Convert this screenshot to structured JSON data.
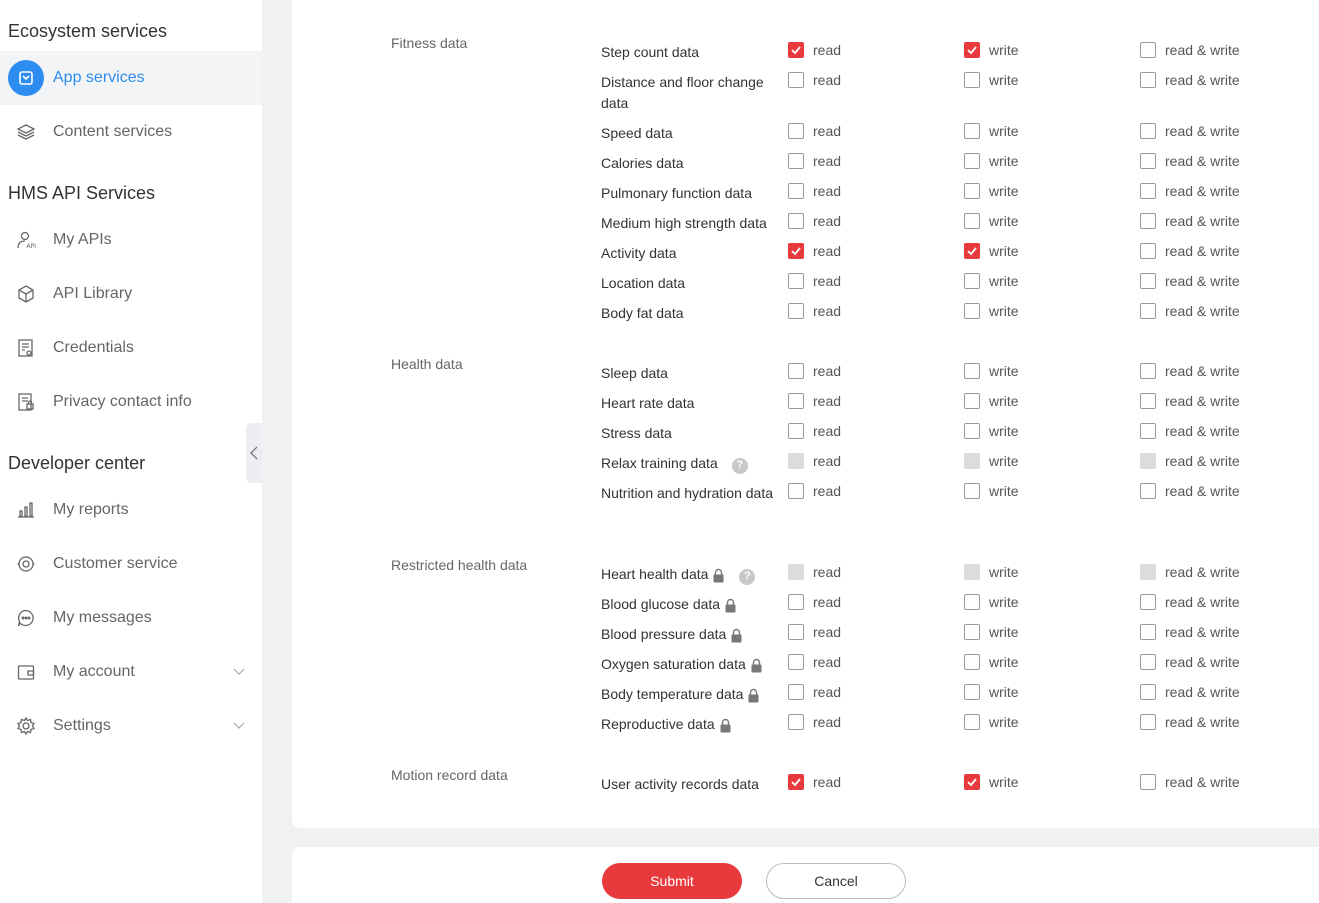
{
  "sidebar": {
    "sections": [
      {
        "title": "Ecosystem services"
      },
      {
        "title": "HMS API Services"
      },
      {
        "title": "Developer center"
      }
    ],
    "items": [
      {
        "label": "App services",
        "icon": "app-services-icon"
      },
      {
        "label": "Content services",
        "icon": "layers-icon"
      },
      {
        "label": "My APIs",
        "icon": "user-api-icon"
      },
      {
        "label": "API Library",
        "icon": "cube-icon"
      },
      {
        "label": "Credentials",
        "icon": "certificate-icon"
      },
      {
        "label": "Privacy contact info",
        "icon": "privacy-doc-icon"
      },
      {
        "label": "My reports",
        "icon": "bar-chart-icon"
      },
      {
        "label": "Customer service",
        "icon": "headset-icon"
      },
      {
        "label": "My messages",
        "icon": "chat-bubble-icon"
      },
      {
        "label": "My account",
        "icon": "wallet-icon"
      },
      {
        "label": "Settings",
        "icon": "gear-icon"
      }
    ]
  },
  "options": {
    "read": "read",
    "write": "write",
    "rw": "read & write"
  },
  "groups": [
    {
      "label": "Fitness data",
      "items": [
        {
          "label": "Step count data",
          "read": "checked",
          "write": "checked",
          "rw": "unchecked"
        },
        {
          "label": "Distance and floor change data",
          "read": "unchecked",
          "write": "unchecked",
          "rw": "unchecked"
        },
        {
          "label": "Speed data",
          "read": "unchecked",
          "write": "unchecked",
          "rw": "unchecked"
        },
        {
          "label": "Calories data",
          "read": "unchecked",
          "write": "unchecked",
          "rw": "unchecked"
        },
        {
          "label": "Pulmonary function data",
          "read": "unchecked",
          "write": "unchecked",
          "rw": "unchecked"
        },
        {
          "label": "Medium high strength data",
          "read": "unchecked",
          "write": "unchecked",
          "rw": "unchecked"
        },
        {
          "label": "Activity data",
          "read": "checked",
          "write": "checked",
          "rw": "unchecked"
        },
        {
          "label": "Location data",
          "read": "unchecked",
          "write": "unchecked",
          "rw": "unchecked"
        },
        {
          "label": "Body fat data",
          "read": "unchecked",
          "write": "unchecked",
          "rw": "unchecked"
        }
      ]
    },
    {
      "label": "Health data",
      "items": [
        {
          "label": "Sleep data",
          "read": "unchecked",
          "write": "unchecked",
          "rw": "unchecked"
        },
        {
          "label": "Heart rate data",
          "read": "unchecked",
          "write": "unchecked",
          "rw": "unchecked"
        },
        {
          "label": "Stress data",
          "read": "unchecked",
          "write": "unchecked",
          "rw": "unchecked"
        },
        {
          "label": "Relax training data",
          "help": "?",
          "read": "disabled",
          "write": "disabled",
          "rw": "disabled"
        },
        {
          "label": "Nutrition and hydration data",
          "read": "unchecked",
          "write": "unchecked",
          "rw": "unchecked"
        }
      ]
    },
    {
      "label": "Restricted health data",
      "items": [
        {
          "label": "Heart health data",
          "lock": true,
          "help": "?",
          "read": "disabled",
          "write": "disabled",
          "rw": "disabled"
        },
        {
          "label": "Blood glucose data",
          "lock": true,
          "read": "unchecked",
          "write": "unchecked",
          "rw": "unchecked"
        },
        {
          "label": "Blood pressure data",
          "lock": true,
          "read": "unchecked",
          "write": "unchecked",
          "rw": "unchecked"
        },
        {
          "label": "Oxygen saturation data",
          "lock": true,
          "read": "unchecked",
          "write": "unchecked",
          "rw": "unchecked"
        },
        {
          "label": "Body temperature data",
          "lock": true,
          "read": "unchecked",
          "write": "unchecked",
          "rw": "unchecked"
        },
        {
          "label": "Reproductive data",
          "lock": true,
          "read": "unchecked",
          "write": "unchecked",
          "rw": "unchecked"
        }
      ]
    },
    {
      "label": "Motion record data",
      "items": [
        {
          "label": "User activity records data",
          "read": "checked",
          "write": "checked",
          "rw": "unchecked"
        }
      ]
    }
  ],
  "footer": {
    "submit": "Submit",
    "cancel": "Cancel"
  },
  "colors": {
    "accent": "#2d8cf0",
    "checked": "#e8393c",
    "disabled": "#dcdcdc"
  }
}
